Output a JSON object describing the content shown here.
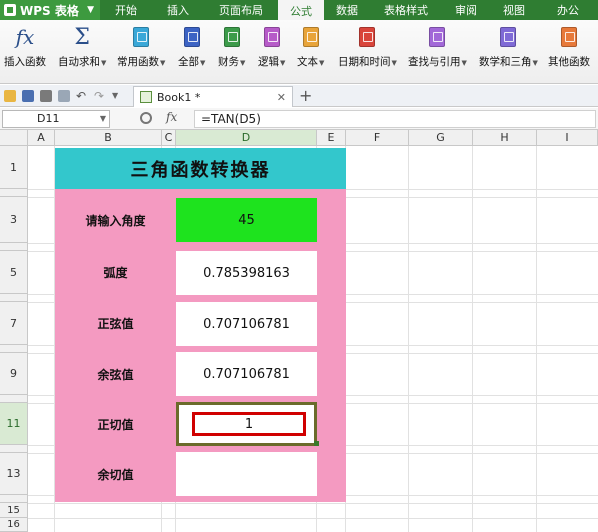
{
  "menubar": {
    "app_name": "WPS 表格",
    "items": [
      "开始",
      "插入",
      "页面布局",
      "公式",
      "数据",
      "表格样式",
      "审阅",
      "视图",
      "办公"
    ],
    "active": "公式"
  },
  "ribbon": {
    "buttons": [
      {
        "label": "插入函数",
        "icon": "fx-icon"
      },
      {
        "label": "自动求和",
        "icon": "sigma-icon",
        "dropdown": true
      },
      {
        "label": "常用函数",
        "icon": "book-icon",
        "dropdown": true,
        "color": "#3aa8d8"
      },
      {
        "label": "全部",
        "icon": "book-icon",
        "dropdown": true,
        "color": "#3c63c4"
      },
      {
        "label": "财务",
        "icon": "book-icon",
        "dropdown": true,
        "color": "#3c9b4a"
      },
      {
        "label": "逻辑",
        "icon": "book-icon",
        "dropdown": true,
        "color": "#b65bc8"
      },
      {
        "label": "文本",
        "icon": "book-icon",
        "dropdown": true,
        "color": "#e8a43a"
      },
      {
        "label": "日期和时间",
        "icon": "book-icon",
        "dropdown": true,
        "color": "#d9453b"
      },
      {
        "label": "查找与引用",
        "icon": "book-icon",
        "dropdown": true,
        "color": "#a268d8"
      },
      {
        "label": "数学和三角",
        "icon": "book-icon",
        "dropdown": true,
        "color": "#7f6ad6"
      },
      {
        "label": "其他函数",
        "icon": "book-icon",
        "dropdown": true,
        "color": "#e7793a"
      }
    ]
  },
  "document": {
    "tab_name": "Book1 *"
  },
  "formula_bar": {
    "cell_ref": "D11",
    "formula": "=TAN(D5)"
  },
  "columns": [
    "A",
    "B",
    "C",
    "D",
    "E",
    "F",
    "G",
    "H",
    "I"
  ],
  "selected_column": "D",
  "rows": [
    "1",
    "3",
    "5",
    "7",
    "9",
    "11",
    "13",
    "15",
    "16"
  ],
  "selected_row": "11",
  "sheet": {
    "title": "三角函数转换器",
    "rows": [
      {
        "label": "请输入角度",
        "value": "45"
      },
      {
        "label": "弧度",
        "value": "0.785398163"
      },
      {
        "label": "正弦值",
        "value": "0.707106781"
      },
      {
        "label": "余弦值",
        "value": "0.707106781"
      },
      {
        "label": "正切值",
        "value": "1"
      },
      {
        "label": "余切值",
        "value": ""
      }
    ]
  },
  "colors": {
    "title_bg": "#33c7cc",
    "panel_bg": "#f49ac1",
    "input_bg": "#1ee31e",
    "menubar": "#2f7d32"
  }
}
